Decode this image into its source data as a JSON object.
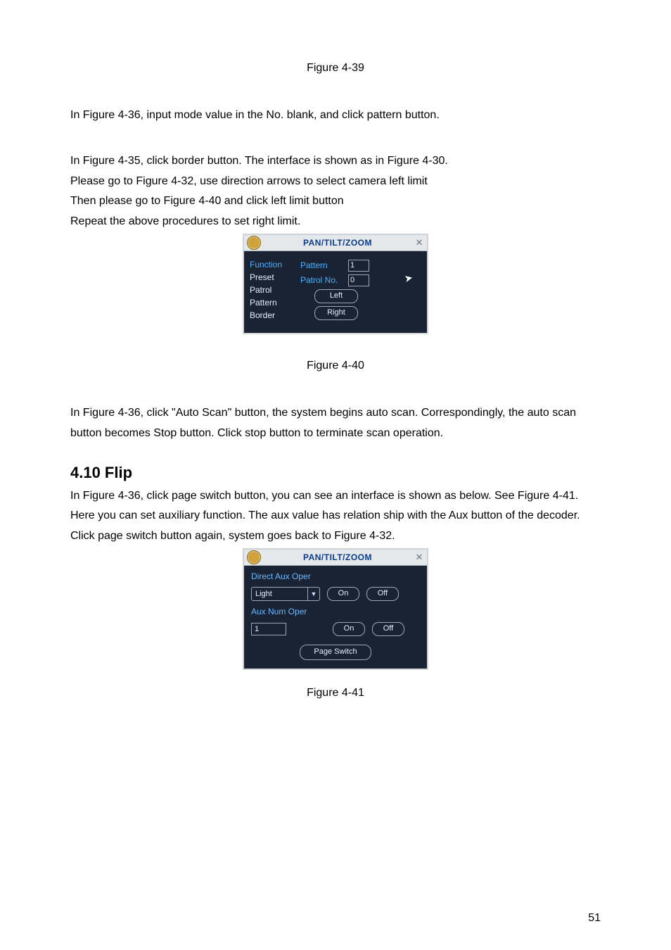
{
  "captions": {
    "fig_39": "Figure 4-39",
    "fig_40": "Figure 4-40",
    "fig_41": "Figure 4-41"
  },
  "paragraphs": {
    "p1": "In Figure 4-36, input mode value in the No. blank, and click pattern button.",
    "p2": "In Figure 4-35, click border button. The interface is shown as in Figure 4-30.",
    "p3": "Please go to Figure 4-32, use direction arrows to select camera left limit",
    "p4": "Then please go to Figure 4-40 and click left limit button",
    "p5": "Repeat the above procedures to set right limit.",
    "p6": "In Figure 4-36, click \"Auto Scan\" button, the system begins auto scan. Correspondingly, the auto scan button becomes Stop button. Click stop button to terminate scan operation.",
    "p7": "In Figure 4-36, click page switch button, you can see an interface is shown as below. See Figure 4-41. Here you can set auxiliary function. The aux value has relation ship with the Aux button of the decoder.",
    "p8": "Click page switch button again, system goes back to Figure 4-32."
  },
  "heading": "4.10 Flip",
  "fig40": {
    "title": "PAN/TILT/ZOOM",
    "left_items": [
      "Function",
      "Preset",
      "Patrol",
      "Pattern",
      "Border"
    ],
    "rows": {
      "pattern_label": "Pattern",
      "pattern_value": "1",
      "patrol_label": "Patrol No.",
      "patrol_value": "0",
      "left_btn": "Left",
      "right_btn": "Right"
    }
  },
  "fig41": {
    "title": "PAN/TILT/ZOOM",
    "direct_label": "Direct Aux Oper",
    "select_value": "Light",
    "on_label": "On",
    "off_label": "Off",
    "auxnum_label": "Aux Num Oper",
    "auxnum_value": "1",
    "page_switch": "Page Switch"
  },
  "page_number": "51"
}
